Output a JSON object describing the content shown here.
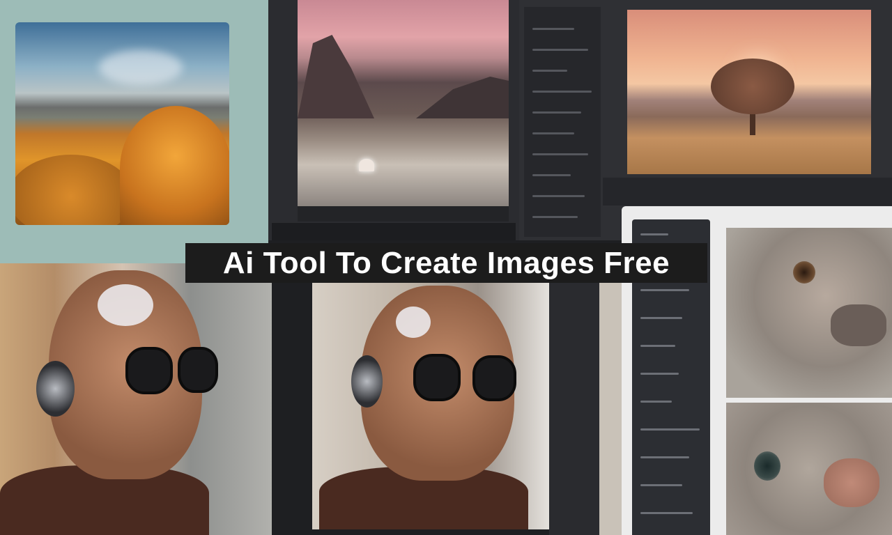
{
  "headline": {
    "text": "Ai Tool To Create Images Free"
  },
  "images": [
    {
      "id": "autumn-forest-icon"
    },
    {
      "id": "valley-landscape-icon"
    },
    {
      "id": "sunset-tree-icon"
    },
    {
      "id": "man-with-headphones-icon"
    },
    {
      "id": "lion-closeup-icon"
    },
    {
      "id": "camel-closeup-icon"
    }
  ],
  "colors": {
    "teal_panel": "#9dbcb7",
    "headline_bg": "#1c1c1c",
    "headline_text": "#ffffff",
    "editor_dark": "#2b2c30",
    "right_panel": "#ececec"
  }
}
